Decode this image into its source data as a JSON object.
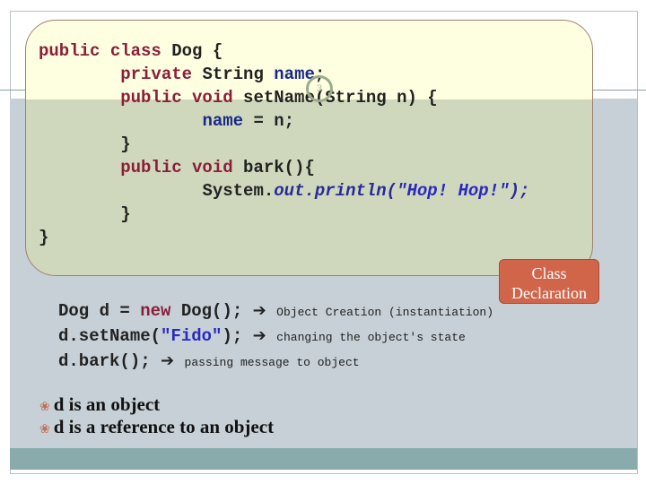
{
  "class_code": {
    "l1": {
      "a": "public class",
      "b": " Dog {"
    },
    "l2": {
      "a": "private",
      "b": " String ",
      "c": "name",
      "d": ";"
    },
    "l3": {
      "a": "public void",
      "b": " setName(String n) {"
    },
    "l4": {
      "a": "name",
      "b": " = n;"
    },
    "l5": "}",
    "l6": {
      "a": "public void",
      "b": " bark(){"
    },
    "l7": {
      "a": "System.",
      "b": "out.println(",
      "c": "\"Hop! Hop!\"",
      "d": ");"
    },
    "l8": "}",
    "l9": "}"
  },
  "slide_number": "3",
  "callout_label": "Class Declaration",
  "usage": [
    {
      "pre": "Dog d = ",
      "kw": "new",
      "post": " Dog();",
      "note": "Object Creation (instantiation)"
    },
    {
      "pre": "d.setName(",
      "str": "\"Fido\"",
      "post": ");",
      "note": "changing the object's state"
    },
    {
      "pre": "d.bark();",
      "note": "passing message to object"
    }
  ],
  "arrow_icon": "➔",
  "bullets": [
    "d is an object",
    "d is a reference to an object"
  ],
  "colors": {
    "callout": "#d0654a",
    "band": "#8aabab",
    "background": "#c6d0d6"
  }
}
